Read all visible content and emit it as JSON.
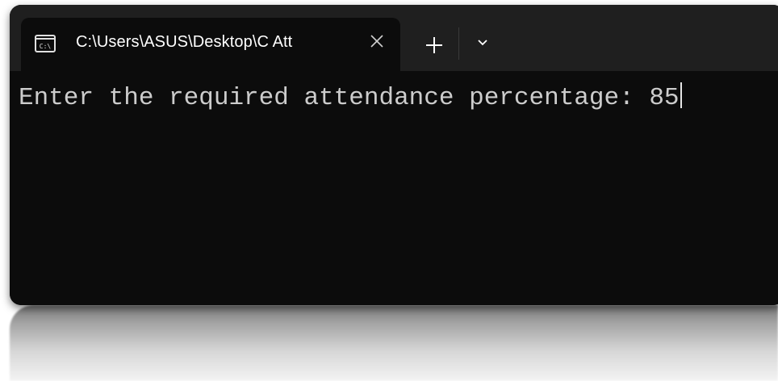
{
  "window": {
    "tab": {
      "icon": "terminal-icon",
      "title": "C:\\Users\\ASUS\\Desktop\\C Att",
      "close_icon": "close-icon"
    },
    "new_tab_icon": "plus-icon",
    "dropdown_icon": "chevron-down-icon"
  },
  "terminal": {
    "prompt": "Enter the required attendance percentage: ",
    "input": "85"
  },
  "colors": {
    "titlebar": "#1f1f1f",
    "background": "#0c0c0c",
    "text": "#cccccc"
  }
}
